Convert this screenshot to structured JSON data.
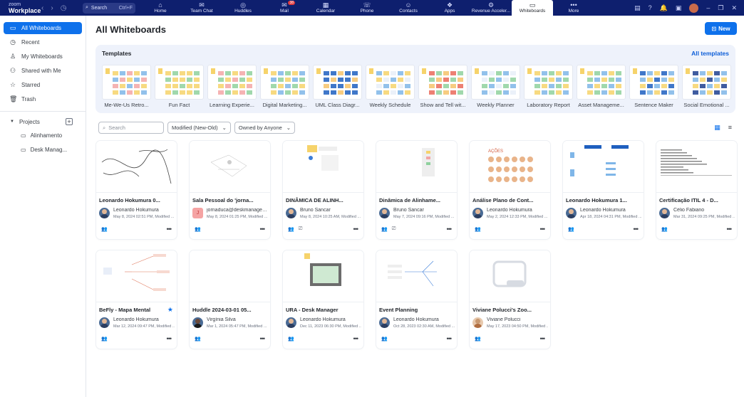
{
  "topbar": {
    "brand_small": "zoom",
    "brand": "Workplace",
    "search_label": "Search",
    "search_shortcut": "Ctrl+F",
    "nav": [
      {
        "label": "Home",
        "icon": "home-icon",
        "glyph": "⌂"
      },
      {
        "label": "Team Chat",
        "icon": "chat-icon",
        "glyph": "✉",
        "badge": ""
      },
      {
        "label": "Huddles",
        "icon": "huddles-icon",
        "glyph": "◎"
      },
      {
        "label": "Mail",
        "icon": "mail-icon",
        "glyph": "✉",
        "badge": "38"
      },
      {
        "label": "Calendar",
        "icon": "calendar-icon",
        "glyph": "▦"
      },
      {
        "label": "Phone",
        "icon": "phone-icon",
        "glyph": "☏"
      },
      {
        "label": "Contacts",
        "icon": "contacts-icon",
        "glyph": "☺"
      },
      {
        "label": "Apps",
        "icon": "apps-icon",
        "glyph": "❖",
        "badge": ""
      },
      {
        "label": "Revenue Acceler...",
        "icon": "revenue-icon",
        "glyph": "⚙"
      },
      {
        "label": "Whiteboards",
        "icon": "whiteboards-icon",
        "glyph": "▭",
        "active": true
      },
      {
        "label": "More",
        "icon": "more-icon",
        "glyph": "•••"
      }
    ]
  },
  "sidebar": {
    "items": [
      {
        "label": "All Whiteboards",
        "icon": "whiteboard-icon",
        "glyph": "▭",
        "active": true
      },
      {
        "label": "Recent",
        "icon": "clock-icon",
        "glyph": "◷"
      },
      {
        "label": "My Whiteboards",
        "icon": "person-icon",
        "glyph": "♙"
      },
      {
        "label": "Shared with Me",
        "icon": "people-icon",
        "glyph": "⚇"
      },
      {
        "label": "Starred",
        "icon": "star-icon",
        "glyph": "☆"
      },
      {
        "label": "Trash",
        "icon": "trash-icon",
        "glyph": "🗑"
      }
    ],
    "projects_label": "Projects",
    "projects": [
      {
        "label": "Alinhamento"
      },
      {
        "label": "Desk Manag..."
      }
    ]
  },
  "main": {
    "title": "All Whiteboards",
    "new_button": "New",
    "templates_label": "Templates",
    "all_templates": "All templates",
    "templates": [
      {
        "name": "Me-We-Us Retro..."
      },
      {
        "name": "Fun Fact"
      },
      {
        "name": "Learning Experie..."
      },
      {
        "name": "Digital Marketing..."
      },
      {
        "name": "UML Class Diagr..."
      },
      {
        "name": "Weekly Schedule"
      },
      {
        "name": "Show and Tell wit..."
      },
      {
        "name": "Weekly Planner"
      },
      {
        "name": "Laboratory Report"
      },
      {
        "name": "Asset Manageme..."
      },
      {
        "name": "Sentence Maker"
      },
      {
        "name": "Social Emotional ..."
      }
    ],
    "search_placeholder": "Search",
    "sort_label": "Modified (New-Old)",
    "owner_filter": "Owned by Anyone",
    "cards": [
      {
        "title": "Leonardo Hokumura 0...",
        "owner": "Leonardo Hokumura",
        "date": "May 8, 2024 02:51 PM, Modified ...",
        "avatar": "man"
      },
      {
        "title": "Sala Pessoal do 'jorna...",
        "owner": "jornaduca@deskmanager....",
        "date": "May 8, 2024 01:25 PM, Modified ...",
        "avatar": "letter",
        "letter": "J"
      },
      {
        "title": "DINÂMICA DE ALINH...",
        "owner": "Bruno Sancar",
        "date": "May 8, 2024 10:25 AM, Modified ...",
        "avatar": "man",
        "video": true
      },
      {
        "title": "Dinâmica de Alinhame...",
        "owner": "Bruno Sancar",
        "date": "May 7, 2024 09:16 PM, Modified ...",
        "avatar": "man",
        "video": true
      },
      {
        "title": "Análise Plano de Cont...",
        "owner": "Leonardo Hokumura",
        "date": "May 2, 2024 12:33 PM, Modified ...",
        "avatar": "man"
      },
      {
        "title": "Leonardo Hokumura 1...",
        "owner": "Leonardo Hokumura",
        "date": "Apr 18, 2024 04:31 PM, Modified ...",
        "avatar": "man"
      },
      {
        "title": "Certificação ITIL 4 - D...",
        "owner": "Célio Fabiano",
        "date": "Mar 31, 2024 09:25 PM, Modified ...",
        "avatar": "man"
      },
      {
        "title": "BeFly - Mapa Mental",
        "owner": "Leonardo Hokumura",
        "date": "Mar 12, 2024 09:47 PM, Modified ...",
        "avatar": "man",
        "starred": true
      },
      {
        "title": "Huddle 2024-03-01 05...",
        "owner": "Virgínia Silva",
        "date": "Mar 1, 2024 05:47 PM, Modified ...",
        "avatar": "fem"
      },
      {
        "title": "URA - Desk Manager",
        "owner": "Leonardo Hokumura",
        "date": "Dec 11, 2023 06:30 PM, Modified ...",
        "avatar": "man"
      },
      {
        "title": "Event Planning",
        "owner": "Leonardo Hokumura",
        "date": "Oct 28, 2023 02:30 AM, Modified ...",
        "avatar": "man"
      },
      {
        "title": "Viviane Polucci's Zoo...",
        "owner": "Viviane Polucci",
        "date": "May 17, 2023 04:50 PM, Modified ...",
        "avatar": "fem2"
      }
    ]
  }
}
